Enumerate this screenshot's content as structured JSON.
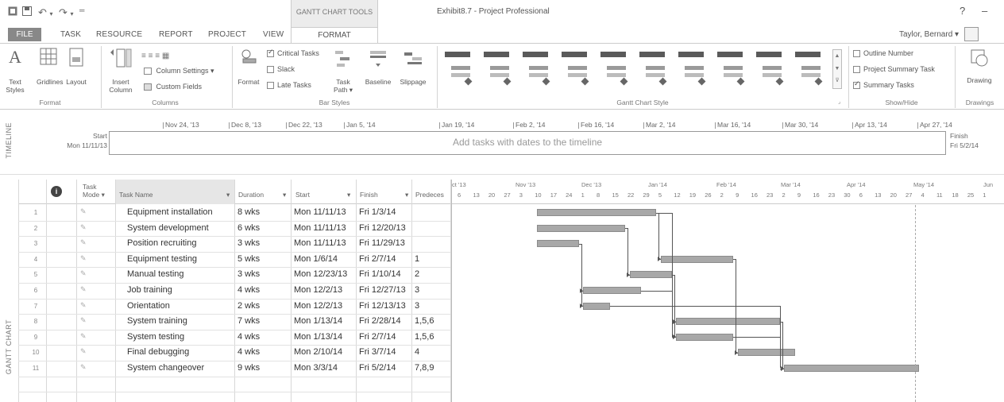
{
  "titlebar": {
    "qa_icons": [
      "project-logo-icon",
      "save-icon",
      "undo-icon",
      "redo-icon",
      "customize-qa-icon"
    ],
    "contextual_group": "GANTT CHART TOOLS",
    "doc_title": "Exhibit8.7 - Project Professional",
    "help": "?",
    "minimize": "–"
  },
  "tabs": {
    "file": "FILE",
    "items": [
      "TASK",
      "RESOURCE",
      "REPORT",
      "PROJECT",
      "VIEW"
    ],
    "format": "FORMAT",
    "user": "Taylor, Bernard ▾"
  },
  "ribbon": {
    "format_group": {
      "label": "Format",
      "text_styles": "Text Styles",
      "gridlines": "Gridlines",
      "layout": "Layout"
    },
    "columns_group": {
      "label": "Columns",
      "insert_column": "Insert Column",
      "column_settings": "Column Settings ▾",
      "custom_fields": "Custom Fields"
    },
    "bar_styles_group": {
      "label": "Bar Styles",
      "format": "Format",
      "critical_tasks": "Critical Tasks",
      "slack": "Slack",
      "late_tasks": "Late Tasks",
      "task_path": "Task Path ▾",
      "baseline": "Baseline",
      "slippage": "Slippage"
    },
    "gantt_style_group": {
      "label": "Gantt Chart Style"
    },
    "show_hide_group": {
      "label": "Show/Hide",
      "outline_number": "Outline Number",
      "project_summary_task": "Project Summary Task",
      "summary_tasks": "Summary Tasks"
    },
    "drawings_group": {
      "label": "Drawings",
      "drawing": "Drawing"
    }
  },
  "timeline": {
    "side_label": "TIMELINE",
    "start_label": "Start",
    "start_date": "Mon 11/11/13",
    "finish_label": "Finish",
    "finish_date": "Fri 5/2/14",
    "placeholder": "Add tasks with dates to the timeline",
    "dates": [
      "Nov 24, '13",
      "Dec 8, '13",
      "Dec 22, '13",
      "Jan 5, '14",
      "Jan 19, '14",
      "Feb 2, '14",
      "Feb 16, '14",
      "Mar 2, '14",
      "Mar 16, '14",
      "Mar 30, '14",
      "Apr 13, '14",
      "Apr 27, '14"
    ]
  },
  "gantt": {
    "side_label": "GANTT CHART",
    "headers": {
      "info": "i",
      "mode_line1": "Task",
      "mode_line2": "Mode ▾",
      "name": "Task Name",
      "duration": "Duration",
      "start": "Start",
      "finish": "Finish",
      "predecessors": "Predeces"
    },
    "months": [
      "ct '13",
      "Nov '13",
      "Dec '13",
      "Jan '14",
      "Feb '14",
      "Mar '14",
      "Apr '14",
      "May '14",
      "Jun"
    ],
    "days": [
      "6",
      "13",
      "20",
      "27",
      "3",
      "10",
      "17",
      "24",
      "1",
      "8",
      "15",
      "22",
      "29",
      "5",
      "12",
      "19",
      "26",
      "2",
      "9",
      "16",
      "23",
      "2",
      "9",
      "16",
      "23",
      "30",
      "6",
      "13",
      "20",
      "27",
      "4",
      "11",
      "18",
      "25",
      "1"
    ],
    "rows": [
      {
        "id": "1",
        "name": "Equipment installation",
        "duration": "8 wks",
        "start": "Mon 11/11/13",
        "finish": "Fri 1/3/14",
        "pred": ""
      },
      {
        "id": "2",
        "name": "System development",
        "duration": "6 wks",
        "start": "Mon 11/11/13",
        "finish": "Fri 12/20/13",
        "pred": ""
      },
      {
        "id": "3",
        "name": "Position recruiting",
        "duration": "3 wks",
        "start": "Mon 11/11/13",
        "finish": "Fri 11/29/13",
        "pred": ""
      },
      {
        "id": "4",
        "name": "Equipment testing",
        "duration": "5 wks",
        "start": "Mon 1/6/14",
        "finish": "Fri 2/7/14",
        "pred": "1"
      },
      {
        "id": "5",
        "name": "Manual testing",
        "duration": "3 wks",
        "start": "Mon 12/23/13",
        "finish": "Fri 1/10/14",
        "pred": "2"
      },
      {
        "id": "6",
        "name": "Job training",
        "duration": "4 wks",
        "start": "Mon 12/2/13",
        "finish": "Fri 12/27/13",
        "pred": "3"
      },
      {
        "id": "7",
        "name": "Orientation",
        "duration": "2 wks",
        "start": "Mon 12/2/13",
        "finish": "Fri 12/13/13",
        "pred": "3"
      },
      {
        "id": "8",
        "name": "System training",
        "duration": "7 wks",
        "start": "Mon 1/13/14",
        "finish": "Fri 2/28/14",
        "pred": "1,5,6"
      },
      {
        "id": "9",
        "name": "System testing",
        "duration": "4 wks",
        "start": "Mon 1/13/14",
        "finish": "Fri 2/7/14",
        "pred": "1,5,6"
      },
      {
        "id": "10",
        "name": "Final debugging",
        "duration": "4 wks",
        "start": "Mon 2/10/14",
        "finish": "Fri 3/7/14",
        "pred": "4"
      },
      {
        "id": "11",
        "name": "System changeover",
        "duration": "9 wks",
        "start": "Mon 3/3/14",
        "finish": "Fri 5/2/14",
        "pred": "7,8,9"
      }
    ]
  }
}
